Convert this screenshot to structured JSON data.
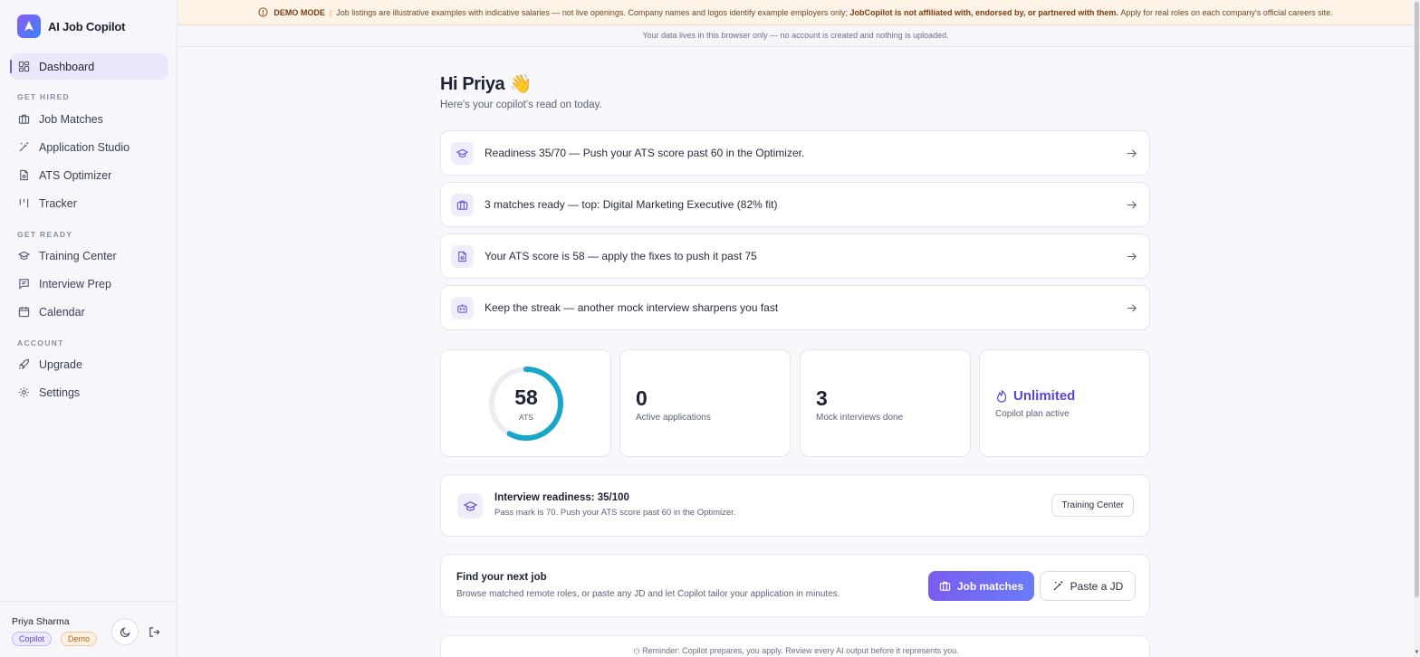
{
  "app": {
    "name": "AI Job Copilot"
  },
  "banner": {
    "mode_label": "DEMO MODE",
    "text_1": "Job listings are illustrative examples with indicative salaries — not live openings. Company names and logos identify example employers only;",
    "text_strong": "JobCopilot is not affiliated with, endorsed by, or partnered with them.",
    "text_2": "Apply for real roles on each company's official careers site.",
    "data_notice": "Your data lives in this browser only — no account is created and nothing is uploaded."
  },
  "sidebar": {
    "dashboard": "Dashboard",
    "sections": {
      "get_hired": "GET HIRED",
      "get_ready": "GET READY",
      "account": "ACCOUNT"
    },
    "items": {
      "job_matches": "Job Matches",
      "application_studio": "Application Studio",
      "ats_optimizer": "ATS Optimizer",
      "tracker": "Tracker",
      "training_center": "Training Center",
      "interview_prep": "Interview Prep",
      "calendar": "Calendar",
      "upgrade": "Upgrade",
      "settings": "Settings"
    },
    "user": {
      "name": "Priya Sharma",
      "badge_plan": "Copilot",
      "badge_mode": "Demo"
    }
  },
  "main": {
    "greeting": "Hi Priya 👋",
    "subtitle": "Here's your copilot's read on today.",
    "actions": [
      "Readiness 35/70 — Push your ATS score past 60 in the Optimizer.",
      "3 matches ready — top: Digital Marketing Executive (82% fit)",
      "Your ATS score is 58 — apply the fixes to push it past 75",
      "Keep the streak — another mock interview sharpens you fast"
    ],
    "stats": {
      "ats": {
        "value": "58",
        "label": "ATS",
        "fraction": 0.58
      },
      "applications": {
        "value": "0",
        "label": "Active applications"
      },
      "mock": {
        "value": "3",
        "label": "Mock interviews done"
      },
      "plan": {
        "value": "Unlimited",
        "label": "Copilot plan active"
      }
    },
    "readiness": {
      "title": "Interview readiness: 35/100",
      "subtitle": "Pass mark is 70. Push your ATS score past 60 in the Optimizer.",
      "button": "Training Center"
    },
    "find_job": {
      "title": "Find your next job",
      "subtitle": "Browse matched remote roles, or paste any JD and let Copilot tailor your application in minutes.",
      "primary_button": "Job matches",
      "secondary_button": "Paste a JD"
    },
    "reminder": "Reminder: Copilot prepares, you apply. Review every AI output before it represents you."
  },
  "colors": {
    "accent": "#6d5ce6",
    "ring": "#1aa6c9",
    "demo_bg": "#fdf3e6"
  }
}
